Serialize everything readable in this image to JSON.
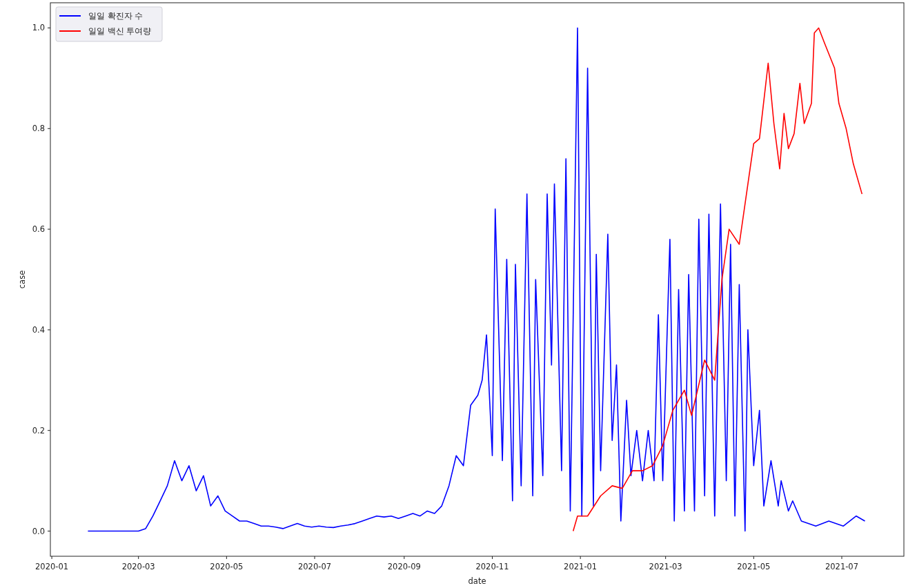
{
  "chart": {
    "chart_data": {
      "type": "line",
      "xlabel": "date",
      "ylabel": "case",
      "legend": true,
      "xlim": [
        "2019-12-31",
        "2021-08-13"
      ],
      "ylim": [
        -0.05,
        1.05
      ],
      "xticks": [
        {
          "value": "2020-01-01",
          "label": "2020-01"
        },
        {
          "value": "2020-03-01",
          "label": "2020-03"
        },
        {
          "value": "2020-05-01",
          "label": "2020-05"
        },
        {
          "value": "2020-07-01",
          "label": "2020-07"
        },
        {
          "value": "2020-09-01",
          "label": "2020-09"
        },
        {
          "value": "2020-11-01",
          "label": "2020-11"
        },
        {
          "value": "2021-01-01",
          "label": "2021-01"
        },
        {
          "value": "2021-03-01",
          "label": "2021-03"
        },
        {
          "value": "2021-05-01",
          "label": "2021-05"
        },
        {
          "value": "2021-07-01",
          "label": "2021-07"
        }
      ],
      "yticks": [
        {
          "value": 0,
          "label": "0.0"
        },
        {
          "value": 0.2,
          "label": "0.2"
        },
        {
          "value": 0.4,
          "label": "0.4"
        },
        {
          "value": 0.6,
          "label": "0.6"
        },
        {
          "value": 0.8,
          "label": "0.8"
        },
        {
          "value": 1,
          "label": "1.0"
        }
      ],
      "series": [
        {
          "name": "일일 확진자 수",
          "color": "#0000ff",
          "x": [
            "2020-01-26",
            "2020-01-31",
            "2020-02-05",
            "2020-02-10",
            "2020-02-15",
            "2020-02-20",
            "2020-02-25",
            "2020-03-01",
            "2020-03-06",
            "2020-03-11",
            "2020-03-16",
            "2020-03-21",
            "2020-03-26",
            "2020-03-31",
            "2020-04-05",
            "2020-04-10",
            "2020-04-15",
            "2020-04-20",
            "2020-04-25",
            "2020-04-30",
            "2020-05-05",
            "2020-05-10",
            "2020-05-15",
            "2020-05-20",
            "2020-05-25",
            "2020-05-30",
            "2020-06-04",
            "2020-06-09",
            "2020-06-14",
            "2020-06-19",
            "2020-06-24",
            "2020-06-29",
            "2020-07-04",
            "2020-07-09",
            "2020-07-14",
            "2020-07-19",
            "2020-07-24",
            "2020-07-29",
            "2020-08-03",
            "2020-08-08",
            "2020-08-13",
            "2020-08-18",
            "2020-08-23",
            "2020-08-28",
            "2020-09-02",
            "2020-09-07",
            "2020-09-12",
            "2020-09-17",
            "2020-09-22",
            "2020-09-27",
            "2020-10-02",
            "2020-10-07",
            "2020-10-12",
            "2020-10-17",
            "2020-10-22",
            "2020-10-25",
            "2020-10-28",
            "2020-11-01",
            "2020-11-03",
            "2020-11-08",
            "2020-11-11",
            "2020-11-15",
            "2020-11-17",
            "2020-11-21",
            "2020-11-25",
            "2020-11-29",
            "2020-12-01",
            "2020-12-06",
            "2020-12-09",
            "2020-12-12",
            "2020-12-14",
            "2020-12-19",
            "2020-12-22",
            "2020-12-25",
            "2020-12-30",
            "2021-01-02",
            "2021-01-06",
            "2021-01-10",
            "2021-01-12",
            "2021-01-15",
            "2021-01-20",
            "2021-01-23",
            "2021-01-26",
            "2021-01-29",
            "2021-02-02",
            "2021-02-05",
            "2021-02-09",
            "2021-02-13",
            "2021-02-17",
            "2021-02-21",
            "2021-02-24",
            "2021-02-27",
            "2021-03-04",
            "2021-03-07",
            "2021-03-10",
            "2021-03-14",
            "2021-03-17",
            "2021-03-21",
            "2021-03-24",
            "2021-03-28",
            "2021-03-31",
            "2021-04-04",
            "2021-04-08",
            "2021-04-12",
            "2021-04-15",
            "2021-04-18",
            "2021-04-21",
            "2021-04-25",
            "2021-04-27",
            "2021-05-01",
            "2021-05-05",
            "2021-05-08",
            "2021-05-13",
            "2021-05-18",
            "2021-05-20",
            "2021-05-25",
            "2021-05-28",
            "2021-06-03",
            "2021-06-13",
            "2021-06-22",
            "2021-07-02",
            "2021-07-11",
            "2021-07-17"
          ],
          "values": [
            0,
            0,
            0,
            0,
            0,
            0,
            0,
            0,
            0.005,
            0.03,
            0.06,
            0.09,
            0.14,
            0.1,
            0.13,
            0.08,
            0.11,
            0.05,
            0.07,
            0.04,
            0.03,
            0.02,
            0.02,
            0.015,
            0.01,
            0.01,
            0.008,
            0.005,
            0.01,
            0.015,
            0.01,
            0.008,
            0.01,
            0.008,
            0.007,
            0.01,
            0.012,
            0.015,
            0.02,
            0.025,
            0.03,
            0.028,
            0.03,
            0.025,
            0.03,
            0.035,
            0.03,
            0.04,
            0.035,
            0.05,
            0.09,
            0.15,
            0.13,
            0.25,
            0.27,
            0.3,
            0.39,
            0.15,
            0.64,
            0.14,
            0.54,
            0.06,
            0.53,
            0.09,
            0.67,
            0.07,
            0.5,
            0.11,
            0.67,
            0.33,
            0.69,
            0.12,
            0.74,
            0.04,
            1.0,
            0.03,
            0.92,
            0.05,
            0.55,
            0.12,
            0.59,
            0.18,
            0.33,
            0.02,
            0.26,
            0.11,
            0.2,
            0.1,
            0.2,
            0.1,
            0.43,
            0.1,
            0.58,
            0.02,
            0.48,
            0.04,
            0.51,
            0.04,
            0.62,
            0.07,
            0.63,
            0.03,
            0.65,
            0.1,
            0.57,
            0.03,
            0.49,
            0,
            0.4,
            0.13,
            0.24,
            0.05,
            0.14,
            0.05,
            0.1,
            0.04,
            0.06,
            0.02,
            0.01,
            0.02,
            0.01,
            0.03,
            0.02
          ]
        },
        {
          "name": "일일 백신 투여량",
          "color": "#ff0000",
          "x": [
            "2020-12-27",
            "2020-12-30",
            "2021-01-06",
            "2021-01-15",
            "2021-01-23",
            "2021-01-30",
            "2021-02-06",
            "2021-02-13",
            "2021-02-20",
            "2021-02-27",
            "2021-03-06",
            "2021-03-14",
            "2021-03-19",
            "2021-03-28",
            "2021-04-04",
            "2021-04-09",
            "2021-04-14",
            "2021-04-21",
            "2021-05-01",
            "2021-05-05",
            "2021-05-11",
            "2021-05-15",
            "2021-05-19",
            "2021-05-22",
            "2021-05-25",
            "2021-05-29",
            "2021-06-02",
            "2021-06-05",
            "2021-06-10",
            "2021-06-12",
            "2021-06-15",
            "2021-06-19",
            "2021-06-26",
            "2021-06-29",
            "2021-07-04",
            "2021-07-09",
            "2021-07-15"
          ],
          "values": [
            0,
            0.03,
            0.03,
            0.07,
            0.09,
            0.085,
            0.12,
            0.12,
            0.13,
            0.17,
            0.24,
            0.28,
            0.23,
            0.34,
            0.3,
            0.5,
            0.6,
            0.57,
            0.77,
            0.78,
            0.93,
            0.81,
            0.72,
            0.83,
            0.76,
            0.79,
            0.89,
            0.81,
            0.85,
            0.99,
            1.0,
            0.97,
            0.92,
            0.85,
            0.8,
            0.73,
            0.67
          ]
        }
      ]
    }
  }
}
